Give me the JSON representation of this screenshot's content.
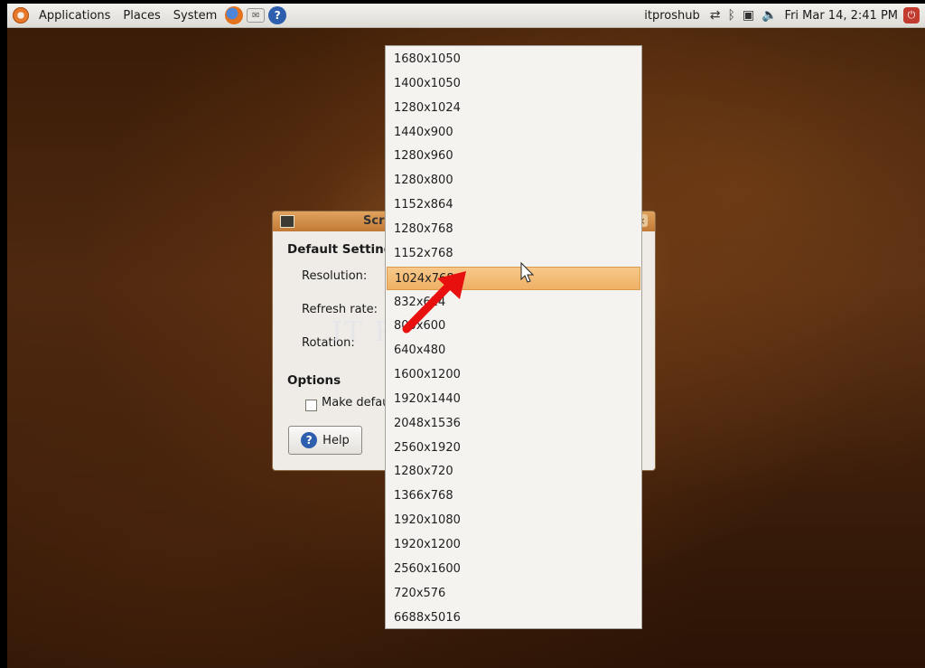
{
  "panel": {
    "menus": [
      "Applications",
      "Places",
      "System"
    ],
    "user": "itproshub",
    "clock": "Fri Mar 14,  2:41 PM",
    "launchers": [
      "firefox-icon",
      "mail-icon",
      "help-icon"
    ],
    "tray_icons": [
      "network-icon",
      "bluetooth-icon",
      "display-icon",
      "volume-icon"
    ]
  },
  "dialog": {
    "title": "Scr",
    "section_default": "Default Setting",
    "resolution_label": "Resolution:",
    "refresh_label": "Refresh rate:",
    "rotation_label": "Rotation:",
    "section_options": "Options",
    "make_default_label": "Make defau",
    "help_label": "Help",
    "help_glyph": "?",
    "close_glyph": "×"
  },
  "watermark": "IT Pros HUB",
  "resolutions": {
    "selected_index": 9,
    "items": [
      "1680x1050",
      "1400x1050",
      "1280x1024",
      "1440x900",
      "1280x960",
      "1280x800",
      "1152x864",
      "1280x768",
      "1152x768",
      "1024x768",
      "832x624",
      "800x600",
      "640x480",
      "1600x1200",
      "1920x1440",
      "2048x1536",
      "2560x1920",
      "1280x720",
      "1366x768",
      "1920x1080",
      "1920x1200",
      "2560x1600",
      "720x576",
      "6688x5016"
    ]
  },
  "colors": {
    "selection": "#efb165",
    "titlebar": "#c27a36",
    "annotation_arrow": "#e8100f"
  }
}
